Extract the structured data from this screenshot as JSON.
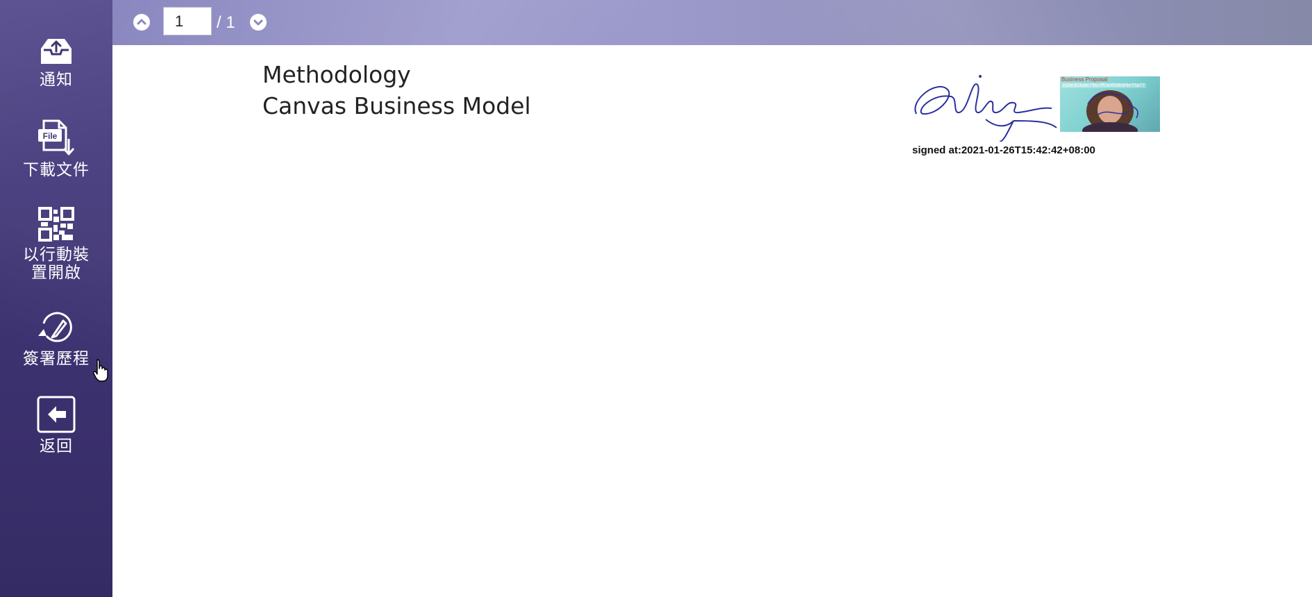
{
  "sidebar": {
    "items": [
      {
        "label": "通知",
        "icon": "inbox-upload-icon"
      },
      {
        "label": "下載文件",
        "icon": "file-download-icon",
        "icon_text": "File"
      },
      {
        "label": "以行動裝\n置開啟",
        "icon": "qr-code-icon"
      },
      {
        "label": "簽署歷程",
        "icon": "sign-history-icon"
      },
      {
        "label": "返回",
        "icon": "back-arrow-icon"
      }
    ]
  },
  "pager": {
    "current_page": "1",
    "total": "/ 1",
    "prev_icon": "chevron-up-icon",
    "next_icon": "chevron-down-icon"
  },
  "document": {
    "line1": "Methodology",
    "line2": "Canvas Business Model",
    "signature": {
      "signed_at": "signed at:2021-01-26T15:42:42+08:00",
      "thumbnail_title": "Business Proposal",
      "thumbnail_hash": "e33e303a8c79b1fff0d4f08b9f4e70a77"
    }
  },
  "colors": {
    "sidebar": "#3f3474",
    "topbar": "#9c9acb",
    "signature_ink": "#2a2f9e"
  }
}
